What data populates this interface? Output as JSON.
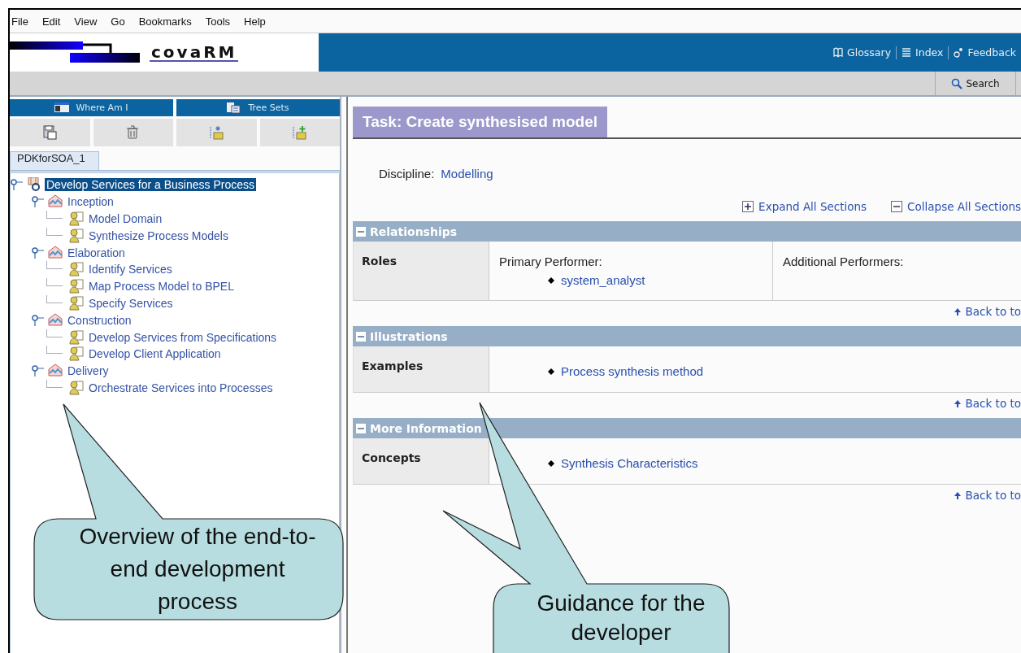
{
  "menu": [
    "File",
    "Edit",
    "View",
    "Go",
    "Bookmarks",
    "Tools",
    "Help"
  ],
  "banner": {
    "logo": "covaRM",
    "links": [
      {
        "label": "Glossary",
        "kind": "book"
      },
      {
        "label": "Index",
        "kind": "list"
      },
      {
        "label": "Feedback",
        "kind": "feedback"
      }
    ]
  },
  "toolbar": {
    "search": "Search"
  },
  "left_panel": {
    "tabs": [
      {
        "label": "Where Am I",
        "kind": "where"
      },
      {
        "label": "Tree Sets",
        "kind": "treesets"
      }
    ],
    "tree_tab": {
      "label": "PDKforSOA_1",
      "selected": true
    },
    "tree": [
      {
        "label": "Develop Services for a Business Process",
        "kind": "process",
        "selected": true,
        "expanded": true,
        "children": [
          {
            "label": "Inception",
            "kind": "phase",
            "selected": false,
            "expanded": true,
            "children": [
              {
                "label": "Model Domain",
                "kind": "task",
                "selected": false
              },
              {
                "label": "Synthesize Process Models",
                "kind": "task",
                "selected": false
              }
            ]
          },
          {
            "label": "Elaboration",
            "kind": "phase",
            "selected": false,
            "expanded": true,
            "children": [
              {
                "label": "Identify Services",
                "kind": "task",
                "selected": false
              },
              {
                "label": "Map Process Model to BPEL",
                "kind": "task",
                "selected": false
              },
              {
                "label": "Specify Services",
                "kind": "task",
                "selected": false
              }
            ]
          },
          {
            "label": "Construction",
            "kind": "phase",
            "selected": false,
            "expanded": true,
            "children": [
              {
                "label": "Develop Services from Specifications",
                "kind": "task",
                "selected": false
              },
              {
                "label": "Develop Client Application",
                "kind": "task",
                "selected": false
              }
            ]
          },
          {
            "label": "Delivery",
            "kind": "phase",
            "selected": false,
            "expanded": true,
            "children": [
              {
                "label": "Orchestrate Services into Processes",
                "kind": "task",
                "selected": false
              }
            ]
          }
        ]
      }
    ]
  },
  "content": {
    "title": "Task: Create synthesised model",
    "discipline": {
      "label": "Discipline:",
      "value": "Modelling"
    },
    "expand_all": "Expand All Sections",
    "collapse_all": "Collapse All Sections",
    "sections": [
      {
        "title": "Relationships",
        "expanded": true,
        "rows": [
          {
            "label": "Roles",
            "cells": [
              {
                "heading": "Primary Performer:",
                "links": [
                  "system_analyst"
                ]
              },
              {
                "heading": "Additional Performers:"
              }
            ]
          }
        ],
        "back_to_top": "Back to to"
      },
      {
        "title": "Illustrations",
        "expanded": true,
        "rows": [
          {
            "label": "Examples",
            "cells": [
              {
                "links": [
                  "Process synthesis method"
                ]
              }
            ]
          }
        ],
        "back_to_top": "Back to to"
      },
      {
        "title": "More Information",
        "expanded": true,
        "rows": [
          {
            "label": "Concepts",
            "cells": [
              {
                "links": [
                  "Synthesis Characteristics"
                ]
              }
            ]
          }
        ],
        "back_to_top": "Back to to"
      }
    ]
  },
  "callouts": [
    {
      "text": "Overview of the end-to-end development process"
    },
    {
      "text": "Guidance for the developer"
    }
  ]
}
